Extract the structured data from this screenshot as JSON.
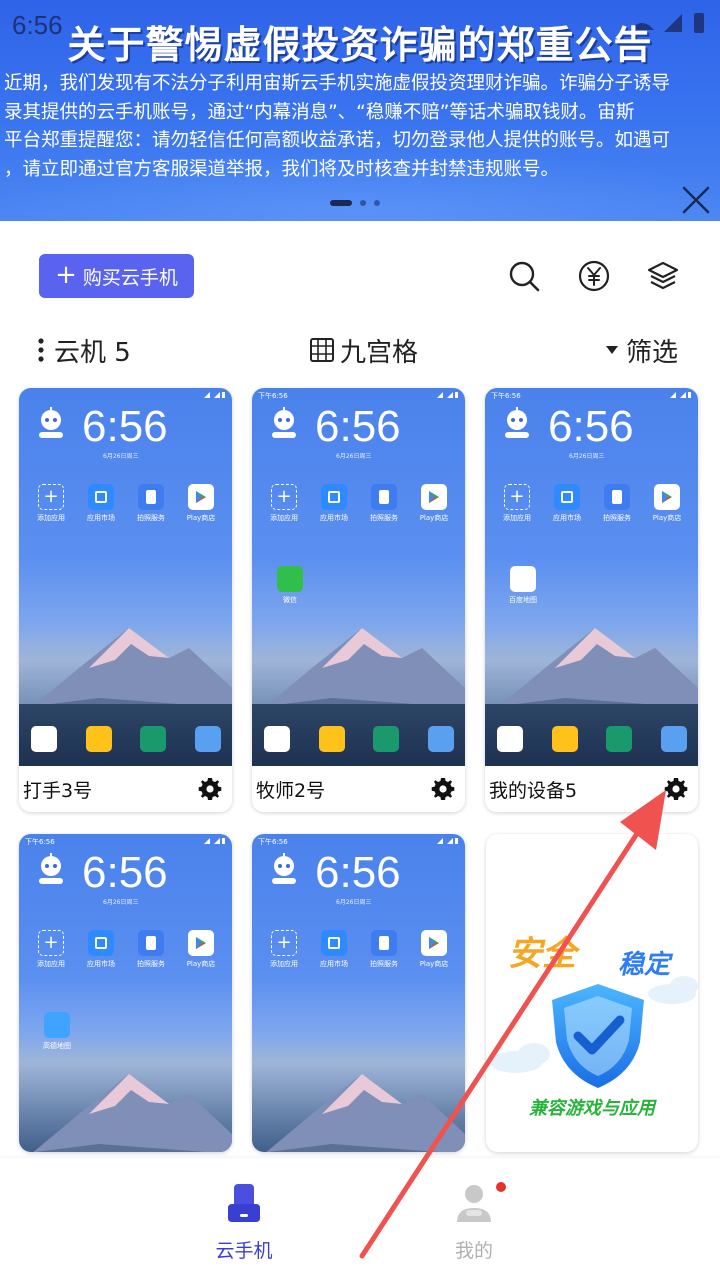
{
  "status_bar": {
    "time": "6:56"
  },
  "banner": {
    "title": "关于警惕虚假投资诈骗的郑重公告",
    "lines": [
      "近期，我们发现有不法分子利用宙斯云手机实施虚假投资理财诈骗。诈骗分子诱导",
      "录其提供的云手机账号，通过“内幕消息”、“稳赚不赔”等话术骗取钱财。宙斯",
      "平台郑重提醒您：请勿轻信任何高额收益承诺，切勿登录他人提供的账号。如遇可",
      "，请立即通过官方客服渠道举报，我们将及时核查并封禁违规账号。"
    ],
    "page_count": 3,
    "active_page": 1
  },
  "toolbar": {
    "buy_label": "购买云手机",
    "icons": [
      "search-icon",
      "yuan-icon",
      "layers-icon"
    ]
  },
  "list_header": {
    "count_label": "云机 5",
    "layout_label": "九宫格",
    "filter_label": "筛选"
  },
  "devices": [
    {
      "name": "打手3号",
      "clock": "6:56",
      "date": "6月26日周三",
      "extra_app": "",
      "status_time": ""
    },
    {
      "name": "牧师2号",
      "clock": "6:56",
      "date": "6月26日周三",
      "extra_app": "微信",
      "status_time": "下午6:56"
    },
    {
      "name": "我的设备5",
      "clock": "6:56",
      "date": "6月26日周三",
      "extra_app": "百度地图",
      "status_time": "下午6:56"
    },
    {
      "name": "",
      "clock": "6:56",
      "date": "6月26日周三",
      "extra_app": "高德地图",
      "status_time": "下午6:56"
    },
    {
      "name": "",
      "clock": "6:56",
      "date": "6月26日周三",
      "extra_app": "",
      "status_time": "下午6:56"
    }
  ],
  "home_apps": [
    "添加应用",
    "应用市场",
    "拍照服务",
    "Play商店"
  ],
  "promo": {
    "title_a": "安全",
    "title_b": "稳定",
    "subtitle": "兼容游戏与应用"
  },
  "bottom_nav": {
    "items": [
      {
        "label": "云手机",
        "active": true
      },
      {
        "label": "我的",
        "active": false
      }
    ]
  },
  "colors": {
    "accent": "#5a63f0",
    "nav_active": "#3a3fd4",
    "banner": "#3a75f0",
    "arrow": "#f0524f"
  }
}
